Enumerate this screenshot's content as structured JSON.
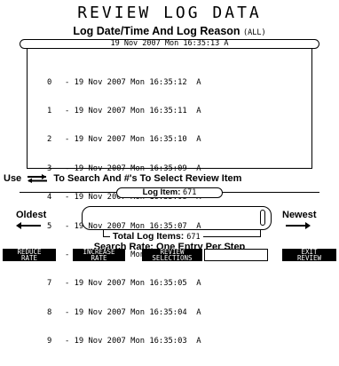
{
  "title": "REVIEW LOG DATA",
  "subtitle": {
    "main": "Log Date/Time And Log Reason",
    "tag": "(ALL)"
  },
  "selected_entry": "19 Nov 2007 Mon 16:35:13  A",
  "log_entries": [
    {
      "index": "0",
      "text": "- 19 Nov 2007 Mon 16:35:12  A"
    },
    {
      "index": "1",
      "text": "- 19 Nov 2007 Mon 16:35:11  A"
    },
    {
      "index": "2",
      "text": "- 19 Nov 2007 Mon 16:35:10  A"
    },
    {
      "index": "3",
      "text": "- 19 Nov 2007 Mon 16:35:09  A"
    },
    {
      "index": "4",
      "text": "- 19 Nov 2007 Mon 16:35:08  A"
    },
    {
      "index": "5",
      "text": "- 19 Nov 2007 Mon 16:35:07  A"
    },
    {
      "index": "6",
      "text": "- 19 Nov 2007 Mon 16:35:06  A"
    },
    {
      "index": "7",
      "text": "- 19 Nov 2007 Mon 16:35:05  A"
    },
    {
      "index": "8",
      "text": "- 19 Nov 2007 Mon 16:35:04  A"
    },
    {
      "index": "9",
      "text": "- 19 Nov 2007 Mon 16:35:03  A"
    }
  ],
  "instruction": {
    "prefix": "Use",
    "icon": "left-right-arrows-icon",
    "suffix": "To Search And #'s To Select Review Item"
  },
  "log_item": {
    "label": "Log Item:",
    "value": "671"
  },
  "scroll": {
    "oldest_label": "Oldest",
    "newest_label": "Newest",
    "position_fraction": 1.0
  },
  "total_items": {
    "label": "Total Log Items:",
    "value": "671"
  },
  "search_rate": "Search Rate: One Entry Per Step",
  "softkeys": {
    "reduce_rate": "REDUCE\nRATE",
    "increase_rate": "INCREASE\nRATE",
    "review_selections": "REVIEW\nSELECTIONS",
    "empty": "",
    "exit_review": "EXIT\nREVIEW"
  }
}
